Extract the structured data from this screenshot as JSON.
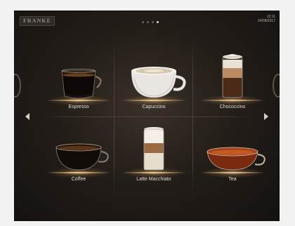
{
  "app": {
    "brand": "FRANKE"
  },
  "status": {
    "time": "12:11",
    "date": "24/08/2017"
  },
  "pager": {
    "pages": 4,
    "active_index": 3
  },
  "products": [
    {
      "label": "Espresso",
      "icon": "espresso-cup-icon"
    },
    {
      "label": "Capuccino",
      "icon": "cappuccino-cup-icon"
    },
    {
      "label": "Chococcino",
      "icon": "chococcino-glass-icon"
    },
    {
      "label": "Coffee",
      "icon": "coffee-cup-icon"
    },
    {
      "label": "Latte Macchiato",
      "icon": "latte-macchiato-glass-icon"
    },
    {
      "label": "Tea",
      "icon": "tea-cup-icon"
    }
  ],
  "colors": {
    "background": "#241e19",
    "glow": "#e8c489",
    "text": "#e6ded5"
  }
}
